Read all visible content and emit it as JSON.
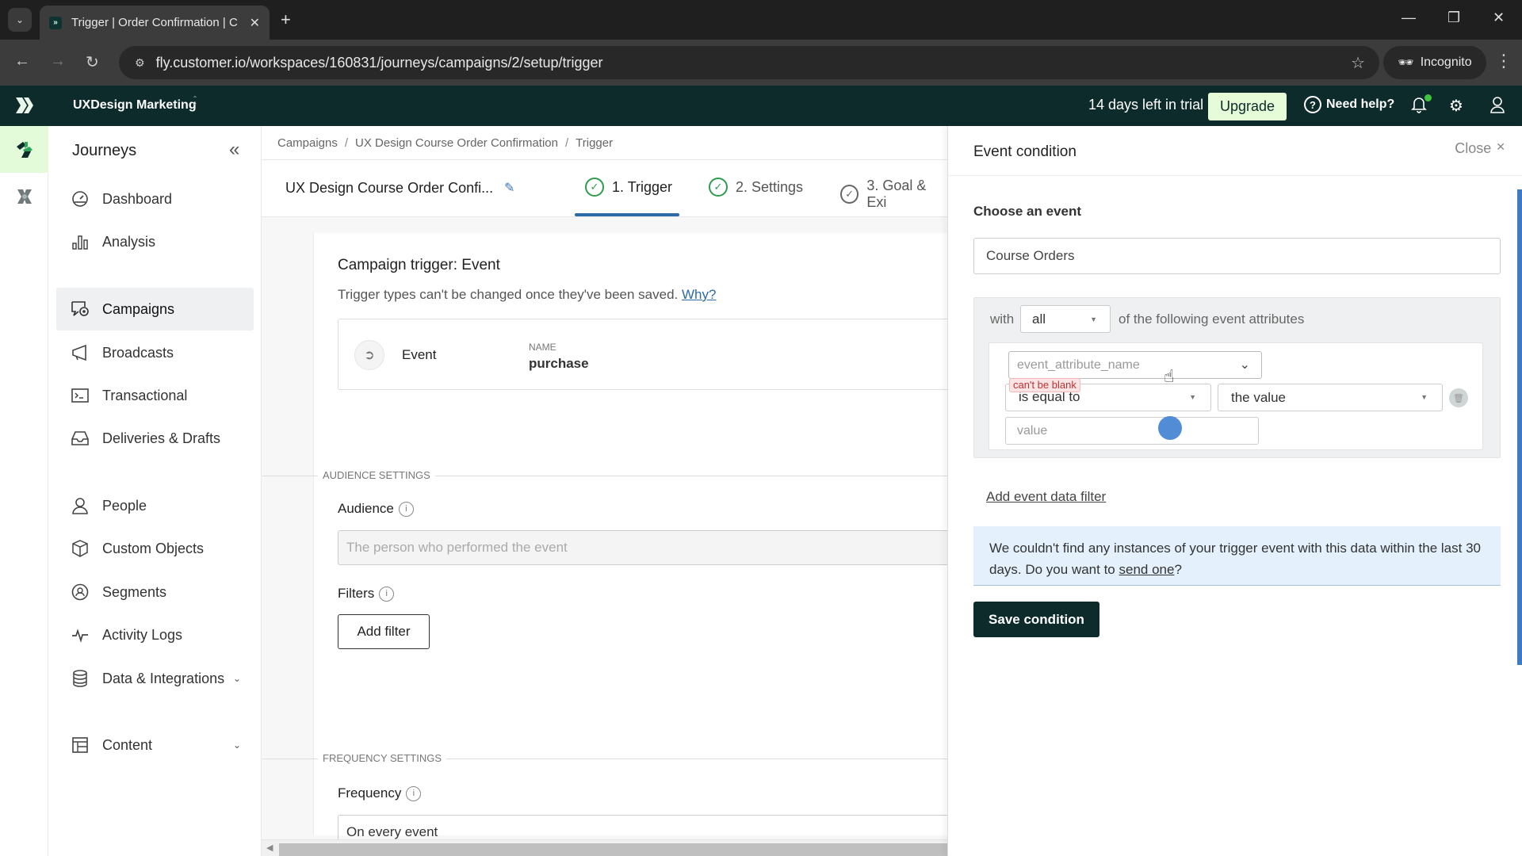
{
  "browser": {
    "tab_title": "Trigger | Order Confirmation | C",
    "url": "fly.customer.io/workspaces/160831/journeys/campaigns/2/setup/trigger",
    "incognito_label": "Incognito"
  },
  "header": {
    "workspace": "UXDesign Marketing",
    "trial_text": "14 days left in trial",
    "upgrade_label": "Upgrade",
    "help_label": "Need help?",
    "notification_dot_color": "#3ec43e"
  },
  "sidebar": {
    "title": "Journeys",
    "items": [
      {
        "label": "Dashboard",
        "icon": "dashboard-icon"
      },
      {
        "label": "Analysis",
        "icon": "bar-chart-icon"
      },
      {
        "label": "Campaigns",
        "icon": "campaigns-icon",
        "active": true
      },
      {
        "label": "Broadcasts",
        "icon": "megaphone-icon"
      },
      {
        "label": "Transactional",
        "icon": "terminal-icon"
      },
      {
        "label": "Deliveries & Drafts",
        "icon": "inbox-icon"
      },
      {
        "label": "People",
        "icon": "person-icon"
      },
      {
        "label": "Custom Objects",
        "icon": "cube-icon"
      },
      {
        "label": "Segments",
        "icon": "segment-icon"
      },
      {
        "label": "Activity Logs",
        "icon": "pulse-icon"
      },
      {
        "label": "Data & Integrations",
        "icon": "database-icon",
        "expandable": true
      },
      {
        "label": "Content",
        "icon": "layout-icon",
        "expandable": true
      }
    ]
  },
  "main": {
    "breadcrumbs": [
      "Campaigns",
      "UX Design Course Order Confirmation",
      "Trigger"
    ],
    "campaign_name": "UX Design Course Order Confi...",
    "steps": [
      {
        "label": "1. Trigger",
        "done": true,
        "active": true
      },
      {
        "label": "2. Settings",
        "done": true
      },
      {
        "label": "3. Goal & Exi",
        "done": false
      }
    ],
    "trigger_heading": "Campaign trigger: Event",
    "trigger_note": "Trigger types can't be changed once they've been saved.",
    "why_link": "Why?",
    "event_type": "Event",
    "event_name_label": "NAME",
    "event_name": "purchase",
    "audience_section": "AUDIENCE SETTINGS",
    "audience_label": "Audience",
    "audience_value": "The person who performed the event",
    "filters_label": "Filters",
    "add_filter_label": "Add filter",
    "frequency_section": "FREQUENCY SETTINGS",
    "frequency_label": "Frequency",
    "frequency_value": "On every event"
  },
  "panel": {
    "title": "Event condition",
    "close_label": "Close",
    "choose_label": "Choose an event",
    "event_value": "Course Orders",
    "with_text": "with",
    "match_value": "all",
    "following_text": "of the following event attributes",
    "attr_placeholder": "event_attribute_name",
    "error_text": "can't be blank",
    "operator_value": "is equal to",
    "compare_value": "the value",
    "value_placeholder": "value",
    "add_data_filter": "Add event data filter",
    "notice_text": "We couldn't find any instances of your trigger event with this data within the last 30 days. Do you want to",
    "notice_link": "send one",
    "notice_end": "?",
    "save_label": "Save condition"
  }
}
